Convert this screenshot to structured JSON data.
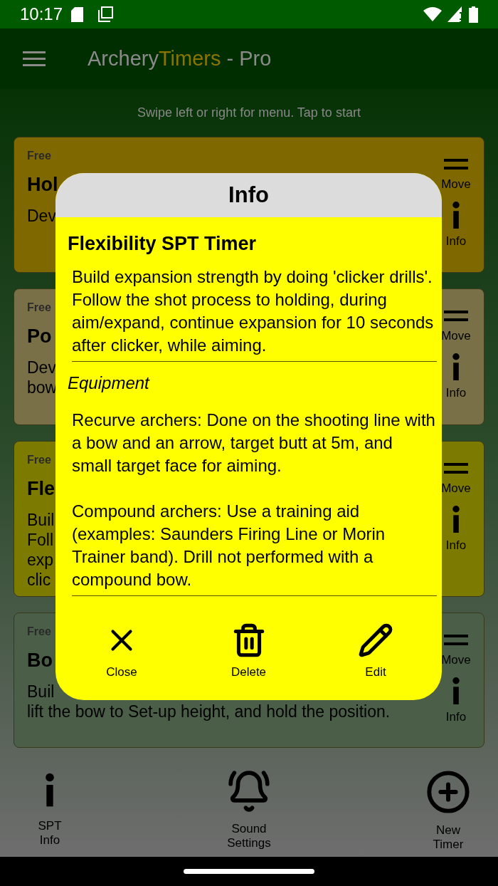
{
  "status_bar": {
    "time": "10:17"
  },
  "app_bar": {
    "title_start": "Archery",
    "title_accent": "Timers",
    "title_end": " - Pro"
  },
  "hint": "Swipe left or right for menu. Tap to start",
  "timers": [
    {
      "tag": "Free",
      "title": "Hol",
      "lines": [
        "Dev"
      ],
      "color": "#7f6800",
      "move_label": "Move",
      "info_label": "Info"
    },
    {
      "tag": "Free",
      "title": "Po",
      "lines": [
        "Dev",
        "bow"
      ],
      "color": "#7a7048",
      "move_label": "Move",
      "info_label": "Info"
    },
    {
      "tag": "Free",
      "title": "Fle",
      "lines": [
        "Buil",
        "Foll",
        "exp",
        "clic"
      ],
      "color": "#7d7a00",
      "move_label": "Move",
      "info_label": "Info"
    },
    {
      "tag": "Free",
      "title": "Bo",
      "lines": [
        "Buil",
        "lift the bow to Set-up height, and hold the position."
      ],
      "color": "#4a5e48",
      "move_label": "Move",
      "info_label": "Info"
    }
  ],
  "dialog": {
    "title": "Info",
    "heading": "Flexibility SPT Timer",
    "description": "Build expansion strength by doing 'clicker drills'. Follow the shot process to holding, during aim/expand, continue expansion for 10 seconds after clicker, while aiming.",
    "section": "Equipment",
    "equipment": [
      "Recurve archers: Done on the shooting line with a bow and an arrow, target butt at 5m, and small target face for aiming.",
      "Compound archers: Use a training aid (examples: Saunders Firing Line or Morin Trainer band). Drill not performed with a compound bow."
    ],
    "actions": [
      {
        "kind": "close",
        "label": "Close"
      },
      {
        "kind": "delete",
        "label": "Delete"
      },
      {
        "kind": "edit",
        "label": "Edit"
      }
    ]
  },
  "bottom_nav": [
    {
      "kind": "info",
      "label": "SPT\nInfo"
    },
    {
      "kind": "sound",
      "label": "Sound\nSettings"
    },
    {
      "kind": "add",
      "label": "New\nTimer"
    }
  ]
}
